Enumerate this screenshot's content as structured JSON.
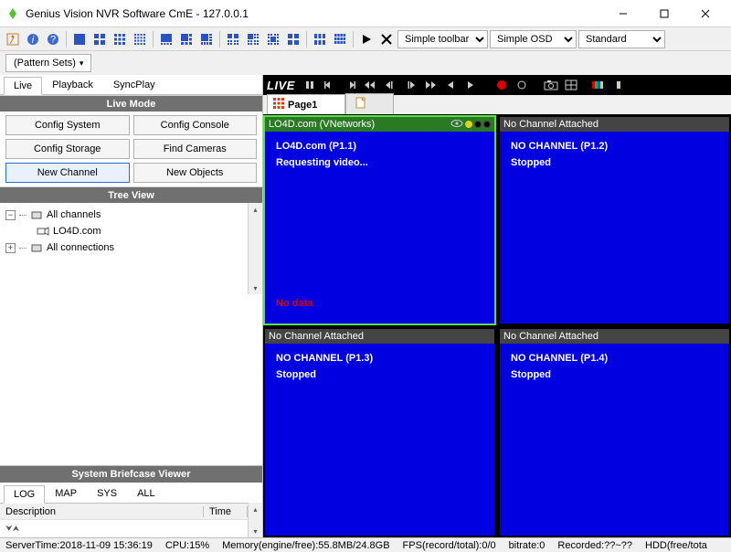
{
  "window": {
    "title": "Genius Vision NVR Software CmE - 127.0.0.1"
  },
  "toolbar": {
    "dropdown1": "Simple toolbar",
    "dropdown2": "Simple OSD",
    "dropdown3": "Standard",
    "pattern_sets": "(Pattern Sets)"
  },
  "left": {
    "tabs": {
      "live": "Live",
      "playback": "Playback",
      "syncplay": "SyncPlay"
    },
    "mode_header": "Live Mode",
    "buttons": {
      "config_system": "Config System",
      "config_console": "Config Console",
      "config_storage": "Config Storage",
      "find_cameras": "Find Cameras",
      "new_channel": "New Channel",
      "new_objects": "New Objects"
    },
    "tree_header": "Tree View",
    "tree": {
      "all_channels": "All channels",
      "channel1": "LO4D.com",
      "all_connections": "All connections"
    },
    "briefcase_header": "System Briefcase Viewer",
    "log_tabs": {
      "log": "LOG",
      "map": "MAP",
      "sys": "SYS",
      "all": "ALL"
    },
    "log_cols": {
      "desc": "Description",
      "time": "Time"
    }
  },
  "viewer": {
    "live_label": "LIVE",
    "page1": "Page1",
    "cells": [
      {
        "title": "LO4D.com (VNetworks)",
        "line1": "LO4D.com (P1.1)",
        "line2": "Requesting video...",
        "no_data": "No data",
        "selected": true
      },
      {
        "title": "No Channel Attached",
        "line1": "NO CHANNEL (P1.2)",
        "line2": "Stopped",
        "selected": false
      },
      {
        "title": "No Channel Attached",
        "line1": "NO CHANNEL (P1.3)",
        "line2": "Stopped",
        "selected": false
      },
      {
        "title": "No Channel Attached",
        "line1": "NO CHANNEL (P1.4)",
        "line2": "Stopped",
        "selected": false
      }
    ]
  },
  "status": {
    "server_time": "ServerTime:2018-11-09 15:36:19",
    "cpu": "CPU:15%",
    "memory": "Memory(engine/free):55.8MB/24.8GB",
    "fps": "FPS(record/total):0/0",
    "bitrate": "bitrate:0",
    "recorded": "Recorded:??~??",
    "hdd": "HDD(free/tota"
  }
}
